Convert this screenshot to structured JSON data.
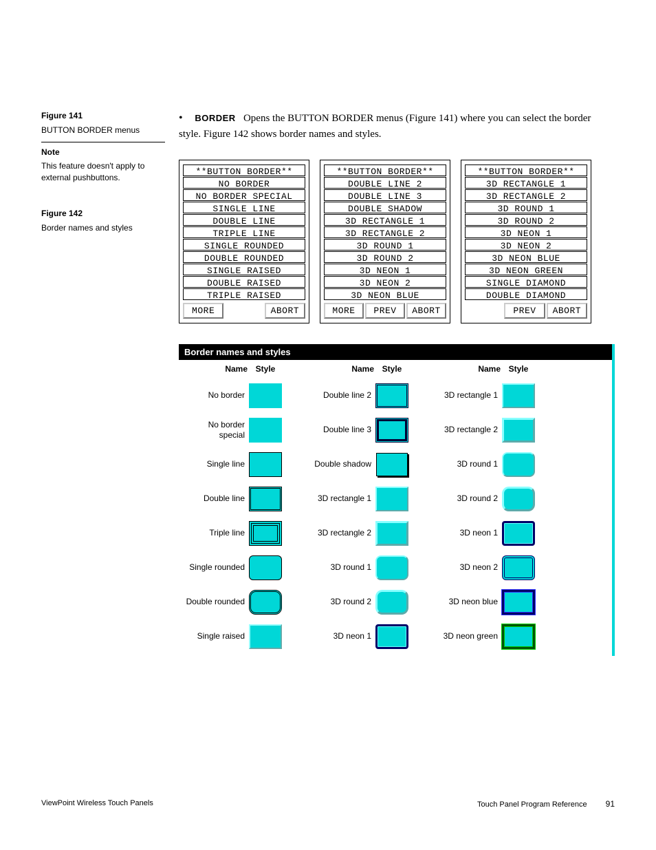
{
  "bullet": {
    "term": "BORDER",
    "text": "Opens the BUTTON BORDER menus (Figure 141) where you can select the border style. Figure 142 shows border names and styles."
  },
  "sidebar": {
    "fig141_label": "Figure 141",
    "fig141_caption": "BUTTON BORDER menus",
    "note_label": "Note",
    "note_text": "This feature doesn't apply to external pushbuttons.",
    "fig142_label": "Figure 142",
    "fig142_caption": "Border names and styles"
  },
  "menus": {
    "title": "**BUTTON BORDER**",
    "col1": [
      "NO BORDER",
      "NO BORDER SPECIAL",
      "SINGLE LINE",
      "DOUBLE LINE",
      "TRIPLE LINE",
      "SINGLE ROUNDED",
      "DOUBLE ROUNDED",
      "SINGLE RAISED",
      "DOUBLE RAISED",
      "TRIPLE RAISED"
    ],
    "col2": [
      "DOUBLE LINE 2",
      "DOUBLE LINE 3",
      "DOUBLE SHADOW",
      "3D RECTANGLE 1",
      "3D RECTANGLE 2",
      "3D ROUND 1",
      "3D ROUND 2",
      "3D NEON 1",
      "3D NEON 2",
      "3D NEON BLUE"
    ],
    "col3": [
      "3D RECTANGLE 1",
      "3D RECTANGLE 2",
      "3D ROUND 1",
      "3D ROUND 2",
      "3D NEON 1",
      "3D NEON 2",
      "3D NEON BLUE",
      "3D NEON GREEN",
      "SINGLE DIAMOND",
      "DOUBLE DIAMOND"
    ],
    "btn_more": "MORE",
    "btn_prev": "PREV",
    "btn_abort": "ABORT"
  },
  "table": {
    "header": "Border names and styles",
    "col_name": "Name",
    "col_style": "Style",
    "col1": [
      {
        "n": "No border",
        "c": "sw-no"
      },
      {
        "n": "No border special",
        "c": "sw-no"
      },
      {
        "n": "Single line",
        "c": "sw-single"
      },
      {
        "n": "Double line",
        "c": "sw-double"
      },
      {
        "n": "Triple line",
        "c": "sw-triple"
      },
      {
        "n": "Single rounded",
        "c": "sw-srnd"
      },
      {
        "n": "Double rounded",
        "c": "sw-drnd"
      },
      {
        "n": "Single raised",
        "c": "sw-sraised"
      }
    ],
    "col2": [
      {
        "n": "Double line 2",
        "c": "sw-dl2"
      },
      {
        "n": "Double line 3",
        "c": "sw-dl3"
      },
      {
        "n": "Double shadow",
        "c": "sw-dshadow"
      },
      {
        "n": "3D rectangle 1",
        "c": "sw-3drect1"
      },
      {
        "n": "3D rectangle 2",
        "c": "sw-3drect2"
      },
      {
        "n": "3D round 1",
        "c": "sw-3drnd1"
      },
      {
        "n": "3D round 2",
        "c": "sw-3drnd2"
      },
      {
        "n": "3D neon 1",
        "c": "sw-neon1"
      }
    ],
    "col3": [
      {
        "n": "3D rectangle 1",
        "c": "sw-3drect1"
      },
      {
        "n": "3D rectangle 2",
        "c": "sw-3drect2"
      },
      {
        "n": "3D round 1",
        "c": "sw-3drnd1"
      },
      {
        "n": "3D round 2",
        "c": "sw-3drnd2"
      },
      {
        "n": "3D neon 1",
        "c": "sw-neon1"
      },
      {
        "n": "3D neon 2",
        "c": "sw-neon2"
      },
      {
        "n": "3D neon blue",
        "c": "sw-neonblue"
      },
      {
        "n": "3D neon green",
        "c": "sw-neongreen"
      }
    ]
  },
  "footer": {
    "left": "ViewPoint Wireless Touch Panels",
    "right": "Touch Panel Program Reference",
    "page": "91"
  }
}
